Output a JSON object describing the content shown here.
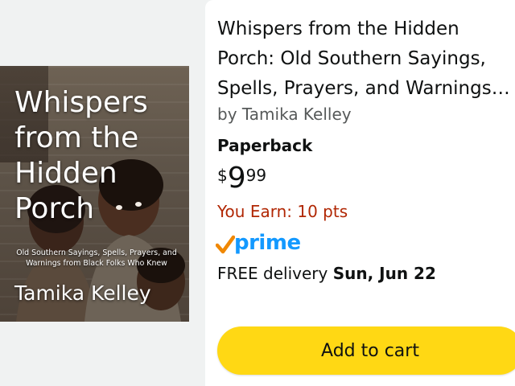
{
  "cover": {
    "title_lines": [
      "Whispers",
      "from the",
      "Hidden",
      "Porch"
    ],
    "subtitle": "Old Southern Sayings, Spells, Prayers, and Warnings from Black Folks Who Knew",
    "author": "Tamika Kelley"
  },
  "product": {
    "title_lines": [
      "Whispers from the Hidden",
      "Porch: Old Southern Sayings,",
      "Spells, Prayers, and Warnings…"
    ],
    "byline": "by Tamika Kelley",
    "format": "Paperback",
    "price": {
      "symbol": "$",
      "whole": "9",
      "fraction": "99"
    },
    "earn": "You Earn: 10 pts",
    "prime_label": "prime",
    "delivery": {
      "prefix": "FREE delivery ",
      "date": "Sun, Jun 22"
    },
    "add_to_cart": "Add to cart"
  },
  "colors": {
    "earn_red": "#b12704",
    "prime_blue": "#1399ff",
    "prime_check": "#f08804",
    "cart_yellow": "#ffd814"
  }
}
